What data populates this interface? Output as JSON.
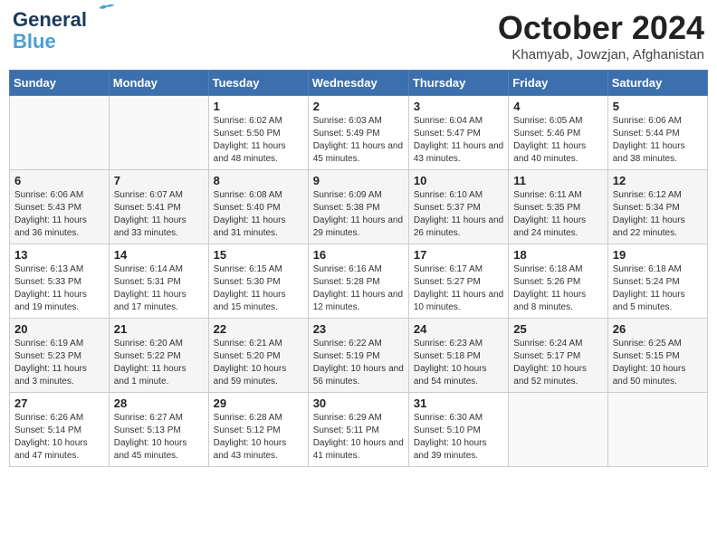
{
  "header": {
    "logo_line1": "General",
    "logo_line2": "Blue",
    "month_title": "October 2024",
    "location": "Khamyab, Jowzjan, Afghanistan"
  },
  "days_of_week": [
    "Sunday",
    "Monday",
    "Tuesday",
    "Wednesday",
    "Thursday",
    "Friday",
    "Saturday"
  ],
  "weeks": [
    [
      {
        "day": "",
        "info": ""
      },
      {
        "day": "",
        "info": ""
      },
      {
        "day": "1",
        "info": "Sunrise: 6:02 AM\nSunset: 5:50 PM\nDaylight: 11 hours and 48 minutes."
      },
      {
        "day": "2",
        "info": "Sunrise: 6:03 AM\nSunset: 5:49 PM\nDaylight: 11 hours and 45 minutes."
      },
      {
        "day": "3",
        "info": "Sunrise: 6:04 AM\nSunset: 5:47 PM\nDaylight: 11 hours and 43 minutes."
      },
      {
        "day": "4",
        "info": "Sunrise: 6:05 AM\nSunset: 5:46 PM\nDaylight: 11 hours and 40 minutes."
      },
      {
        "day": "5",
        "info": "Sunrise: 6:06 AM\nSunset: 5:44 PM\nDaylight: 11 hours and 38 minutes."
      }
    ],
    [
      {
        "day": "6",
        "info": "Sunrise: 6:06 AM\nSunset: 5:43 PM\nDaylight: 11 hours and 36 minutes."
      },
      {
        "day": "7",
        "info": "Sunrise: 6:07 AM\nSunset: 5:41 PM\nDaylight: 11 hours and 33 minutes."
      },
      {
        "day": "8",
        "info": "Sunrise: 6:08 AM\nSunset: 5:40 PM\nDaylight: 11 hours and 31 minutes."
      },
      {
        "day": "9",
        "info": "Sunrise: 6:09 AM\nSunset: 5:38 PM\nDaylight: 11 hours and 29 minutes."
      },
      {
        "day": "10",
        "info": "Sunrise: 6:10 AM\nSunset: 5:37 PM\nDaylight: 11 hours and 26 minutes."
      },
      {
        "day": "11",
        "info": "Sunrise: 6:11 AM\nSunset: 5:35 PM\nDaylight: 11 hours and 24 minutes."
      },
      {
        "day": "12",
        "info": "Sunrise: 6:12 AM\nSunset: 5:34 PM\nDaylight: 11 hours and 22 minutes."
      }
    ],
    [
      {
        "day": "13",
        "info": "Sunrise: 6:13 AM\nSunset: 5:33 PM\nDaylight: 11 hours and 19 minutes."
      },
      {
        "day": "14",
        "info": "Sunrise: 6:14 AM\nSunset: 5:31 PM\nDaylight: 11 hours and 17 minutes."
      },
      {
        "day": "15",
        "info": "Sunrise: 6:15 AM\nSunset: 5:30 PM\nDaylight: 11 hours and 15 minutes."
      },
      {
        "day": "16",
        "info": "Sunrise: 6:16 AM\nSunset: 5:28 PM\nDaylight: 11 hours and 12 minutes."
      },
      {
        "day": "17",
        "info": "Sunrise: 6:17 AM\nSunset: 5:27 PM\nDaylight: 11 hours and 10 minutes."
      },
      {
        "day": "18",
        "info": "Sunrise: 6:18 AM\nSunset: 5:26 PM\nDaylight: 11 hours and 8 minutes."
      },
      {
        "day": "19",
        "info": "Sunrise: 6:18 AM\nSunset: 5:24 PM\nDaylight: 11 hours and 5 minutes."
      }
    ],
    [
      {
        "day": "20",
        "info": "Sunrise: 6:19 AM\nSunset: 5:23 PM\nDaylight: 11 hours and 3 minutes."
      },
      {
        "day": "21",
        "info": "Sunrise: 6:20 AM\nSunset: 5:22 PM\nDaylight: 11 hours and 1 minute."
      },
      {
        "day": "22",
        "info": "Sunrise: 6:21 AM\nSunset: 5:20 PM\nDaylight: 10 hours and 59 minutes."
      },
      {
        "day": "23",
        "info": "Sunrise: 6:22 AM\nSunset: 5:19 PM\nDaylight: 10 hours and 56 minutes."
      },
      {
        "day": "24",
        "info": "Sunrise: 6:23 AM\nSunset: 5:18 PM\nDaylight: 10 hours and 54 minutes."
      },
      {
        "day": "25",
        "info": "Sunrise: 6:24 AM\nSunset: 5:17 PM\nDaylight: 10 hours and 52 minutes."
      },
      {
        "day": "26",
        "info": "Sunrise: 6:25 AM\nSunset: 5:15 PM\nDaylight: 10 hours and 50 minutes."
      }
    ],
    [
      {
        "day": "27",
        "info": "Sunrise: 6:26 AM\nSunset: 5:14 PM\nDaylight: 10 hours and 47 minutes."
      },
      {
        "day": "28",
        "info": "Sunrise: 6:27 AM\nSunset: 5:13 PM\nDaylight: 10 hours and 45 minutes."
      },
      {
        "day": "29",
        "info": "Sunrise: 6:28 AM\nSunset: 5:12 PM\nDaylight: 10 hours and 43 minutes."
      },
      {
        "day": "30",
        "info": "Sunrise: 6:29 AM\nSunset: 5:11 PM\nDaylight: 10 hours and 41 minutes."
      },
      {
        "day": "31",
        "info": "Sunrise: 6:30 AM\nSunset: 5:10 PM\nDaylight: 10 hours and 39 minutes."
      },
      {
        "day": "",
        "info": ""
      },
      {
        "day": "",
        "info": ""
      }
    ]
  ]
}
